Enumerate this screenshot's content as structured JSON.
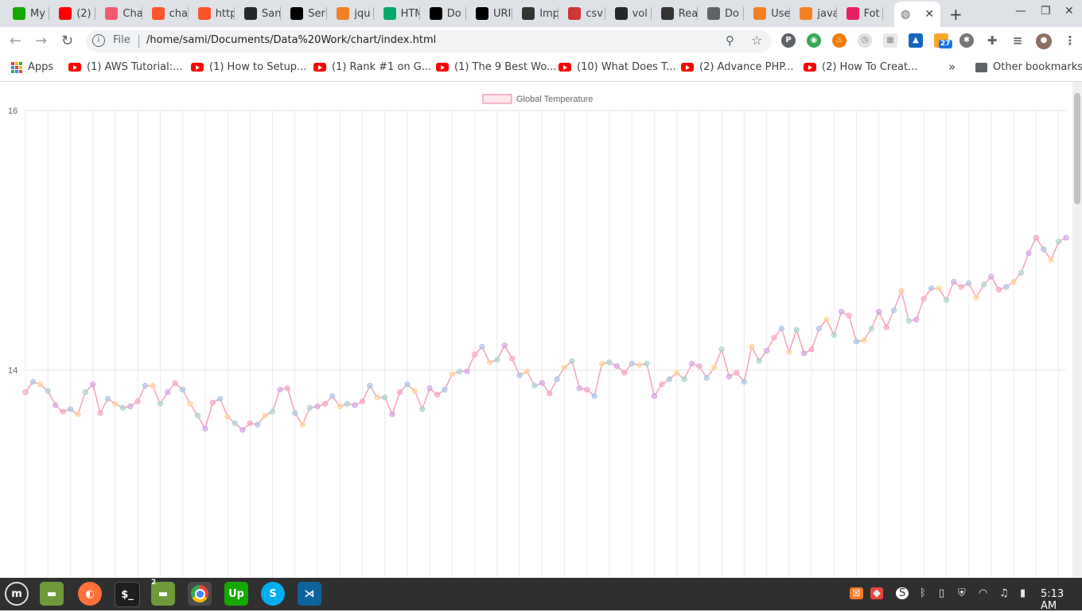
{
  "browser": {
    "tabs": [
      {
        "label": "My",
        "icon": "upwork-icon",
        "color": "#14a800"
      },
      {
        "label": "(2)",
        "icon": "youtube-icon",
        "color": "#ff0000"
      },
      {
        "label": "Cha",
        "icon": "chart-icon",
        "color": "#ef5a6f"
      },
      {
        "label": "cha",
        "icon": "brave-icon",
        "color": "#fb542b"
      },
      {
        "label": "http",
        "icon": "brave-icon",
        "color": "#fb542b"
      },
      {
        "label": "San",
        "icon": "github-icon",
        "color": "#24292e"
      },
      {
        "label": "Ser",
        "icon": "codepen-icon",
        "color": "#000000"
      },
      {
        "label": "jqu",
        "icon": "stackoverflow-icon",
        "color": "#f48024"
      },
      {
        "label": "HTM",
        "icon": "w3-icon",
        "color": "#04aa6d"
      },
      {
        "label": "Do",
        "icon": "codepen-icon",
        "color": "#000000"
      },
      {
        "label": "URI",
        "icon": "codepen-icon",
        "color": "#000000"
      },
      {
        "label": "Imp",
        "icon": "zapier-icon",
        "color": "#333333"
      },
      {
        "label": "csv",
        "icon": "npm-icon",
        "color": "#cb3837"
      },
      {
        "label": "vol",
        "icon": "github-icon",
        "color": "#24292e"
      },
      {
        "label": "Rea",
        "icon": "sa-icon",
        "color": "#333333"
      },
      {
        "label": "Do",
        "icon": "globe-icon",
        "color": "#5f6368"
      },
      {
        "label": "Use",
        "icon": "stackoverflow-icon",
        "color": "#f48024"
      },
      {
        "label": "java",
        "icon": "stackoverflow-icon",
        "color": "#f48024"
      },
      {
        "label": "Fot",
        "icon": "fotor-icon",
        "color": "#e91e63"
      }
    ],
    "active_tab_icon": "globe-icon",
    "address": {
      "scheme_label": "File",
      "url": "/home/sami/Documents/Data%20Work/chart/index.html"
    },
    "extension_badge": "27",
    "bookmarks": [
      "(1) AWS Tutorial:...",
      "(1) How to Setup...",
      "(1) Rank #1 on G...",
      "(1) The 9 Best Wo...",
      "(10) What Does T...",
      "(2) Advance PHP...",
      "(2) How To Creat..."
    ],
    "apps_label": "Apps",
    "more_bookmarks": "»",
    "other_bookmarks": "Other bookmarks"
  },
  "chart_data": {
    "type": "line",
    "legend": [
      "Global Temperature"
    ],
    "legend_position": "top",
    "series": [
      {
        "name": "Global Temperature",
        "line_color": "#f4a3b8",
        "values": [
          13.83,
          13.91,
          13.89,
          13.84,
          13.73,
          13.68,
          13.7,
          13.66,
          13.83,
          13.89,
          13.67,
          13.78,
          13.74,
          13.71,
          13.72,
          13.76,
          13.88,
          13.88,
          13.74,
          13.83,
          13.9,
          13.85,
          13.74,
          13.65,
          13.55,
          13.75,
          13.78,
          13.64,
          13.59,
          13.54,
          13.59,
          13.58,
          13.65,
          13.68,
          13.85,
          13.86,
          13.67,
          13.58,
          13.71,
          13.72,
          13.74,
          13.8,
          13.72,
          13.74,
          13.73,
          13.76,
          13.88,
          13.79,
          13.79,
          13.66,
          13.83,
          13.89,
          13.84,
          13.7,
          13.86,
          13.81,
          13.85,
          13.97,
          13.99,
          13.99,
          14.12,
          14.18,
          14.06,
          14.08,
          14.19,
          14.09,
          13.96,
          13.99,
          13.88,
          13.9,
          13.82,
          13.93,
          14.02,
          14.07,
          13.86,
          13.85,
          13.8,
          14.05,
          14.06,
          14.03,
          13.98,
          14.05,
          14.04,
          14.05,
          13.8,
          13.89,
          13.93,
          13.98,
          13.93,
          14.05,
          14.03,
          13.94,
          14.02,
          14.16,
          13.95,
          13.98,
          13.91,
          14.18,
          14.07,
          14.15,
          14.25,
          14.32,
          14.14,
          14.31,
          14.13,
          14.16,
          14.32,
          14.39,
          14.27,
          14.45,
          14.42,
          14.22,
          14.23,
          14.32,
          14.45,
          14.33,
          14.46,
          14.61,
          14.38,
          14.39,
          14.55,
          14.63,
          14.63,
          14.54,
          14.68,
          14.64,
          14.67,
          14.56,
          14.66,
          14.72,
          14.62,
          14.64,
          14.68,
          14.75,
          14.9,
          15.02,
          14.93,
          14.85,
          14.99,
          15.02
        ]
      }
    ],
    "point_colors": [
      "#f7a8c4",
      "#a9c9e8",
      "#fdd69a",
      "#a9d7d3",
      "#d4a8e6"
    ],
    "x_tick_labels": [],
    "y_tick_labels": [
      "14",
      "16"
    ],
    "ylim": [
      12.4,
      16
    ],
    "grid": true
  },
  "taskbar": {
    "apps": [
      {
        "icon": "mint-menu-icon"
      },
      {
        "icon": "folder-icon"
      },
      {
        "icon": "firefox-icon"
      },
      {
        "icon": "terminal-icon",
        "label": "$_"
      },
      {
        "icon": "folder-icon",
        "badge": "2"
      },
      {
        "icon": "chrome-icon"
      },
      {
        "icon": "upwork-icon",
        "label": "Up"
      },
      {
        "icon": "skype-icon",
        "label": "S"
      },
      {
        "icon": "vscode-icon"
      }
    ],
    "tray_icons": [
      "xampp-icon",
      "anydesk-icon",
      "skype-tray-icon",
      "bluetooth-icon",
      "clipboard-icon",
      "shield-icon",
      "wifi-icon",
      "music-icon",
      "battery-icon"
    ],
    "time": "5:13 AM"
  }
}
